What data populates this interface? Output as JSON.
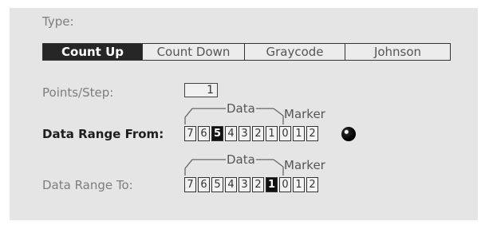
{
  "type_section": {
    "label": "Type:",
    "options": [
      "Count Up",
      "Count Down",
      "Graycode",
      "Johnson"
    ],
    "selected": "Count Up"
  },
  "points_per_step": {
    "label": "Points/Step:",
    "value": "1"
  },
  "data_range_from": {
    "label": "Data Range From:",
    "annotation_data": "Data",
    "annotation_marker": "Marker",
    "data_bits": [
      "7",
      "6",
      "5",
      "4",
      "3",
      "2",
      "1",
      "0"
    ],
    "marker_bits": [
      "1",
      "2"
    ],
    "active_bit": "5"
  },
  "data_range_to": {
    "label": "Data Range To:",
    "annotation_data": "Data",
    "annotation_marker": "Marker",
    "data_bits": [
      "7",
      "6",
      "5",
      "4",
      "3",
      "2",
      "1",
      "0"
    ],
    "marker_bits": [
      "1",
      "2"
    ],
    "active_bit": "1"
  },
  "colors": {
    "panel": "#e5e5e5",
    "selected_fill": "#262626",
    "dim_text": "#7d7d7d"
  },
  "icons": {
    "indicator": "radio-ball-icon"
  }
}
